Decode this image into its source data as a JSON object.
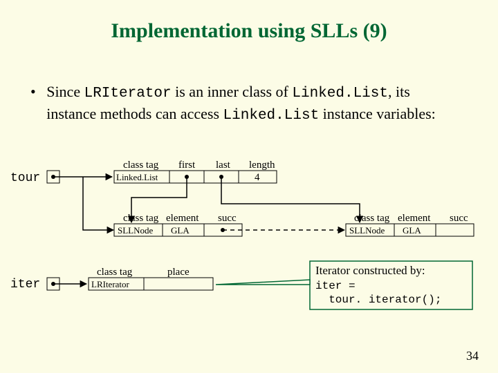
{
  "title": "Implementation using SLLs (9)",
  "bullet": {
    "pre": "Since ",
    "code1": "LRIterator",
    "mid1": " is an inner class of ",
    "code2": "Linked.List",
    "mid2": ", its instance methods can access ",
    "code3": "Linked.List",
    "post": " instance variables:"
  },
  "labels": {
    "tour": "tour",
    "iter": "iter",
    "class_tag": "class tag",
    "first": "first",
    "last": "last",
    "length": "length",
    "length_val": "4",
    "element": "element",
    "succ": "succ",
    "place": "place",
    "linkedlist": "Linked.List",
    "sllnode": "SLLNode",
    "gla": "GLA",
    "lriterator": "LRIterator"
  },
  "callout": {
    "l1": "Iterator constructed by:",
    "l2": "iter =",
    "l3": "  tour. iterator();"
  },
  "page": "34"
}
